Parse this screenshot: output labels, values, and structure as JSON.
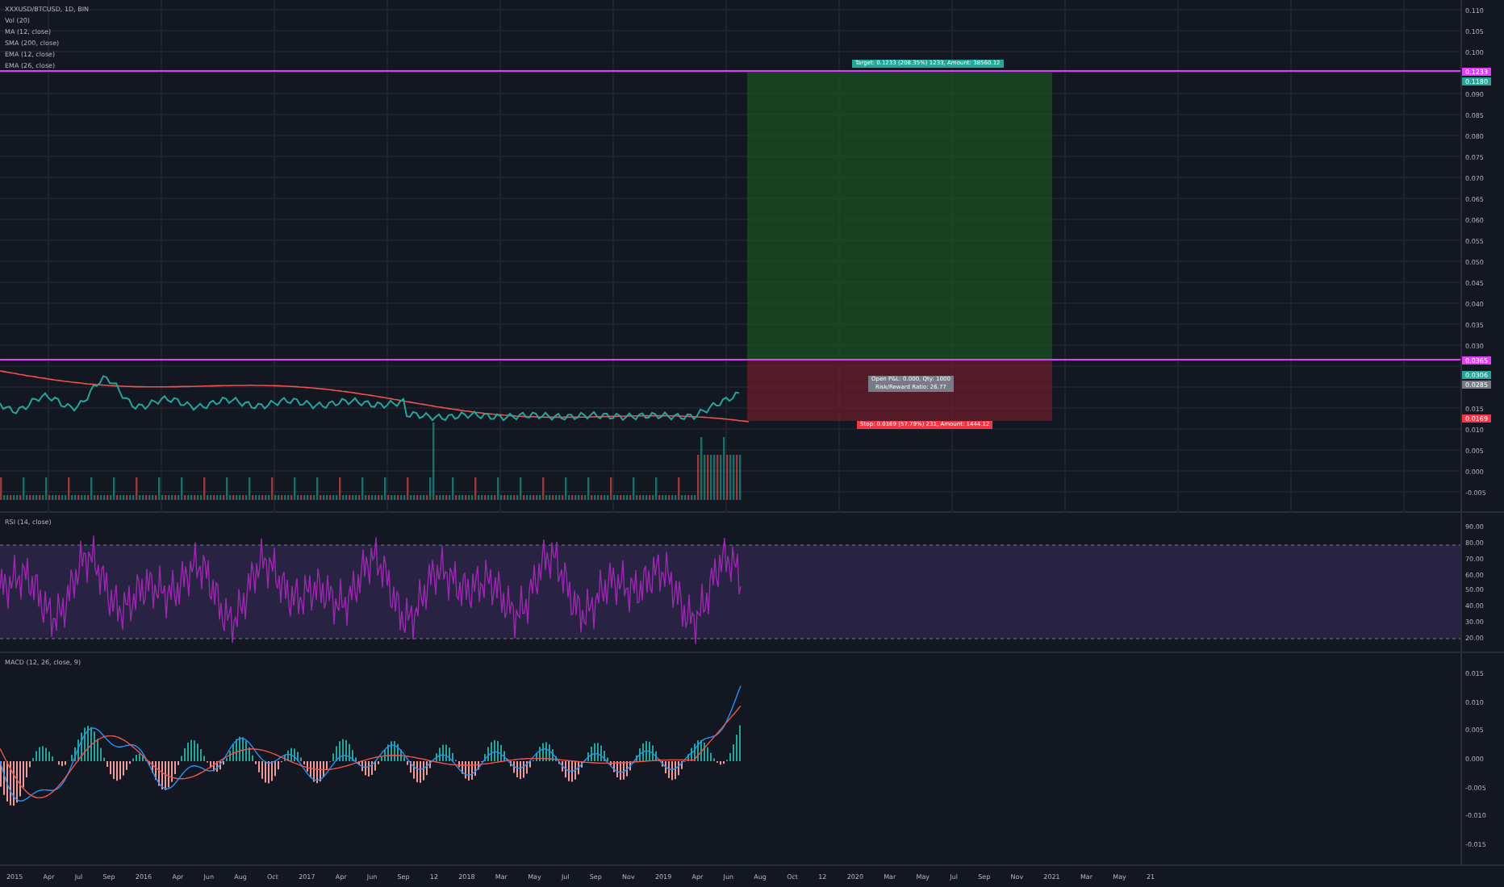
{
  "legend": {
    "title": "XXXUSD/BTCUSD, 1D, BIN",
    "indicators": [
      "Vol (20)",
      "MA (12, close)",
      "SMA (200, close)",
      "EMA (12, close)",
      "EMA (26, close)"
    ]
  },
  "price_axis": {
    "ticks": [
      "0.110",
      "0.105",
      "0.100",
      "0.090",
      "0.085",
      "0.080",
      "0.075",
      "0.070",
      "0.065",
      "0.060",
      "0.055",
      "0.050",
      "0.045",
      "0.040",
      "0.035",
      "0.030",
      "0.015",
      "0.010",
      "0.005",
      "0.000",
      "-0.005"
    ],
    "badges": [
      {
        "text": "0.1233",
        "color": "#e040fb"
      },
      {
        "text": "0.1180",
        "color": "#26a69a"
      },
      {
        "text": "0.0365",
        "color": "#e040fb"
      },
      {
        "text": "0.0306",
        "color": "#26a69a"
      },
      {
        "text": "0.0285",
        "color": "#787b86"
      },
      {
        "text": "0.0169",
        "color": "#f23645"
      }
    ]
  },
  "position": {
    "target_label": "Target: 0.1233 (208.35%) 1233, Amount: 38560.12",
    "info_lines": [
      "Open P&L: 0.000, Qty: 1000",
      "Risk/Reward Ratio: 26.77"
    ],
    "stop_label": "Stop: 0.0169 (57.79%) 231, Amount: 1444.12"
  },
  "rsi": {
    "label": "RSI (14, close)",
    "ticks": [
      "90.00",
      "80.00",
      "70.00",
      "60.00",
      "50.00",
      "40.00",
      "30.00",
      "20.00"
    ]
  },
  "macd": {
    "label": "MACD (12, 26, close, 9)",
    "ticks": [
      "0.015",
      "0.010",
      "0.005",
      "0.000",
      "-0.005",
      "-0.010",
      "-0.015"
    ]
  },
  "time_axis": {
    "ticks": [
      "2015",
      "Apr",
      "Jul",
      "Sep",
      "2016",
      "Apr",
      "Jun",
      "Aug",
      "Oct",
      "2017",
      "Apr",
      "Jun",
      "Sep",
      "12",
      "2018",
      "Mar",
      "May",
      "Jul",
      "Sep",
      "Nov",
      "2019",
      "Apr",
      "Jun",
      "Aug",
      "Oct",
      "12",
      "2020",
      "Mar",
      "May",
      "Jul",
      "Sep",
      "Nov",
      "2021",
      "Mar",
      "May",
      "21"
    ]
  }
}
